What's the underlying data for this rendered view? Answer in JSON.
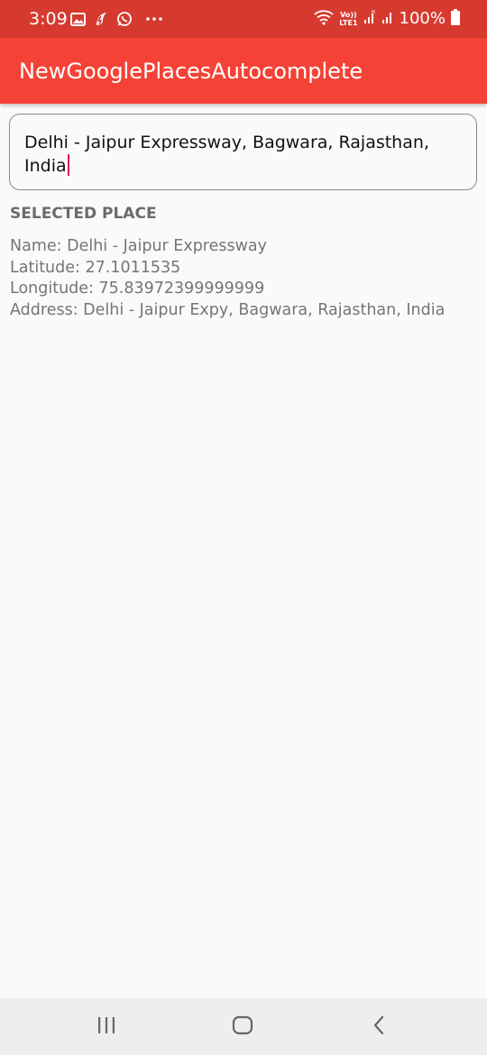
{
  "status_bar": {
    "time": "3:09",
    "left_icons": [
      "image-icon",
      "bolt-app-icon",
      "whatsapp-icon",
      "more-dots-icon"
    ],
    "right_icons": [
      "wifi-icon",
      "volte-icon",
      "signal-icon",
      "signal-icon"
    ],
    "network_label_top": "Vo))",
    "network_label_bottom": "LTE1",
    "battery_percent": "100%"
  },
  "app_bar": {
    "title": "NewGooglePlacesAutocomplete",
    "color": "#f44336"
  },
  "search": {
    "value": "Delhi - Jaipur Expressway, Bagwara, Rajasthan, India"
  },
  "selected_place": {
    "heading": "SELECTED PLACE",
    "name": "Name: Delhi - Jaipur Expressway",
    "latitude": "Latitude: 27.1011535",
    "longitude": "Longitude: 75.83972399999999",
    "address": "Address: Delhi - Jaipur Expy, Bagwara, Rajasthan, India"
  },
  "nav_bar": {
    "buttons": [
      "recents-icon",
      "home-icon",
      "back-icon"
    ]
  }
}
